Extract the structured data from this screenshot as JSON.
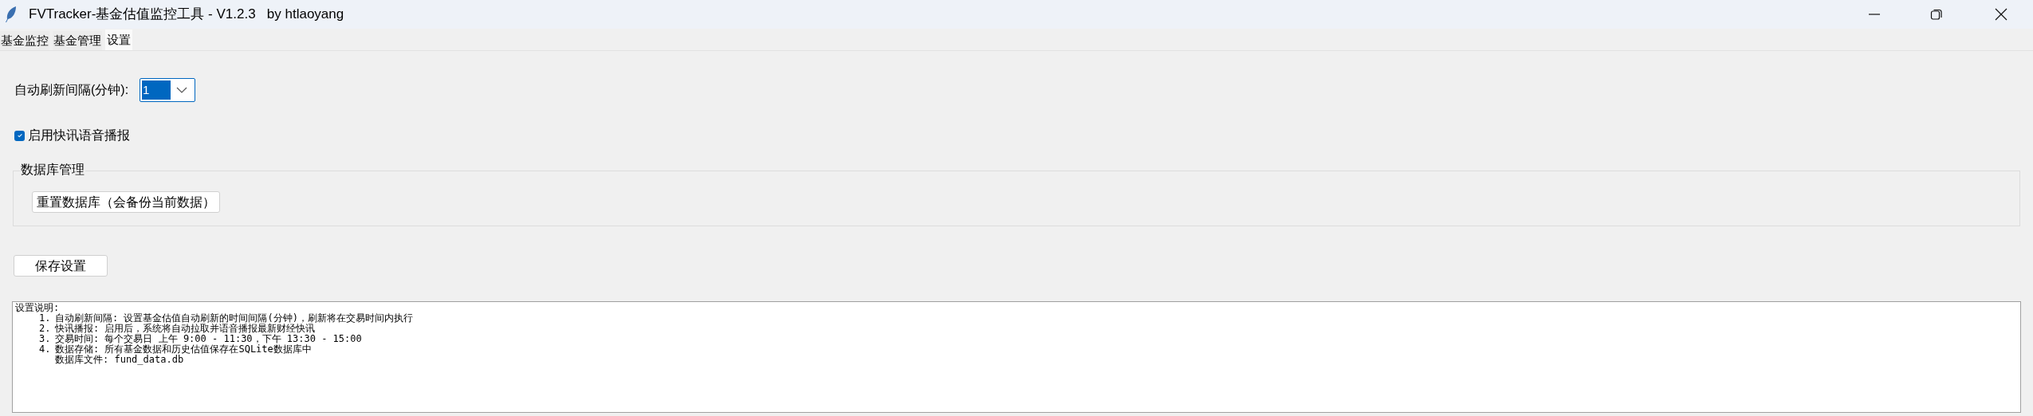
{
  "window": {
    "title": "FVTracker-基金估值监控工具 - V1.2.3   by htlaoyang"
  },
  "tabs": [
    {
      "label": "基金监控",
      "selected": false
    },
    {
      "label": "基金管理",
      "selected": false
    },
    {
      "label": "设置",
      "selected": true
    }
  ],
  "refresh": {
    "label": "自动刷新间隔(分钟):",
    "value": "1"
  },
  "voice": {
    "label": "启用快讯语音播报",
    "checked": true
  },
  "database": {
    "title": "数据库管理",
    "button": "重置数据库（会备份当前数据）"
  },
  "save_button": "保存设置",
  "notes": {
    "title": "设置说明:",
    "items": [
      {
        "number": "1.",
        "lines": [
          "自动刷新间隔: 设置基金估值自动刷新的时间间隔(分钟)，刷新将在交易时间内执行"
        ]
      },
      {
        "number": "2.",
        "lines": [
          "快讯播报: 启用后，系统将自动拉取并语音播报最新财经快讯"
        ]
      },
      {
        "number": "3.",
        "lines": [
          "交易时间: 每个交易日 上午 9:00 - 11:30，下午 13:30 - 15:00"
        ]
      },
      {
        "number": "4.",
        "lines": [
          "数据存储: 所有基金数据和历史估值保存在SQLite数据库中",
          "数据库文件: fund_data.db"
        ]
      }
    ]
  }
}
